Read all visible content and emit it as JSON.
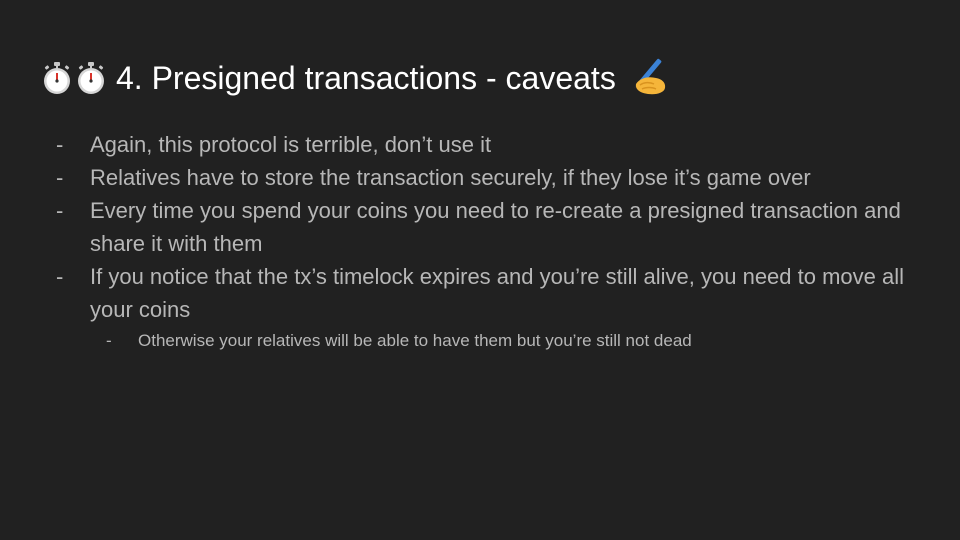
{
  "slide": {
    "title": "4. Presigned transactions - caveats",
    "title_icons": [
      "stopwatch-icon",
      "stopwatch-icon",
      "writing-hand-icon"
    ],
    "bullet_marker": "-",
    "bullets": [
      "Again, this protocol is terrible, don’t use it",
      "Relatives have to store the transaction securely, if they lose it’s game over",
      "Every time you spend your coins you need to re-create a presigned transaction and share it with them",
      "If you notice that the tx’s timelock expires and you’re still alive, you need to move all your coins"
    ],
    "sub_bullets": [
      "Otherwise your relatives will be able to have them but you’re still not dead"
    ]
  },
  "colors": {
    "background": "#212121",
    "title": "#ffffff",
    "body_text": "#b7b7b7"
  }
}
